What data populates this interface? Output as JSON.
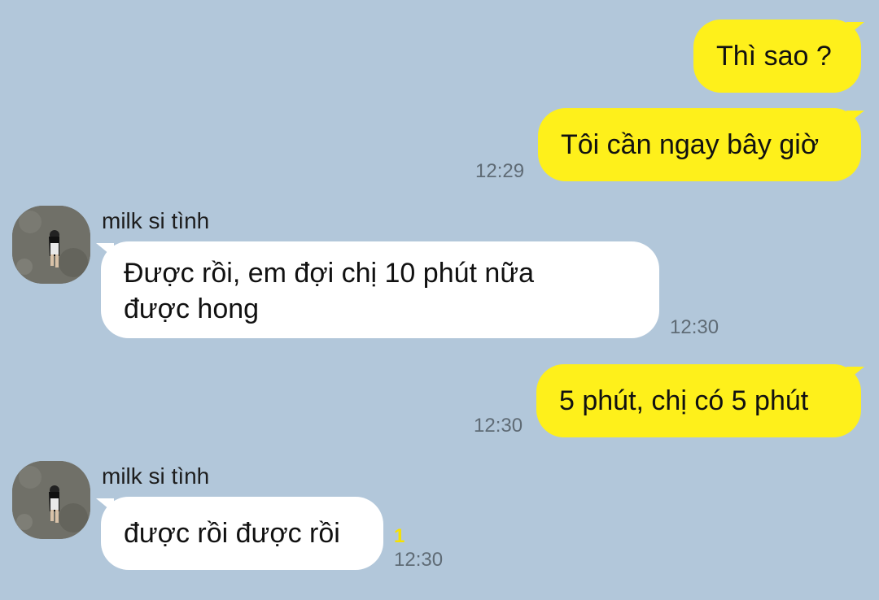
{
  "colors": {
    "background": "#b2c7da",
    "my_bubble": "#fef01b",
    "other_bubble": "#ffffff",
    "timestamp": "#5f6b75",
    "unread_count": "#f6e100"
  },
  "messages": [
    {
      "side": "me",
      "text": "Thì sao ?",
      "time": ""
    },
    {
      "side": "me",
      "text": "Tôi cần ngay bây giờ",
      "time": "12:29"
    },
    {
      "side": "other",
      "sender": "milk si tình",
      "avatar": "profile-photo-girl-walking",
      "text_line1": "Được rồi, em đợi chị 10 phút nữa",
      "text_line2": "được hong",
      "time": "12:30"
    },
    {
      "side": "me",
      "text": "5 phút, chị có 5 phút",
      "time": "12:30"
    },
    {
      "side": "other",
      "sender": "milk si tình",
      "avatar": "profile-photo-girl-walking",
      "text": "được rồi được rồi",
      "unread": "1",
      "time": "12:30"
    }
  ]
}
